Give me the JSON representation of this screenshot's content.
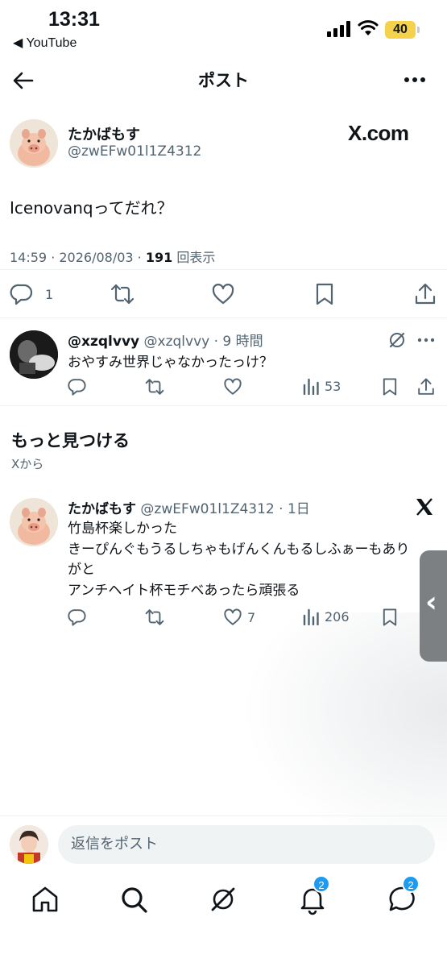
{
  "status_bar": {
    "time": "13:31",
    "back_app": "◀ YouTube",
    "battery": "40"
  },
  "header": {
    "title": "ポスト"
  },
  "main_post": {
    "author_name": "たかばもす",
    "handle": "@zwEFw01l1Z4312",
    "badge": "X.com",
    "text": "Icenovanqってだれ？",
    "timestamp": "14:59 · 2026/08/03 · ",
    "views_count": "191",
    "views_label": " 回表示",
    "reply_count": "1"
  },
  "reply": {
    "author_name": "@xzqlvvy",
    "handle_time": " @xzqlvvy · 9 時間",
    "text": "おやすみ世界じゃなかったっけ？",
    "views": "53"
  },
  "discover": {
    "title": "もっと見つける",
    "subtitle": "Xから"
  },
  "recommended": {
    "author_name": "たかばもす",
    "handle_time": " @zwEFw01l1Z4312 · 1日",
    "lines": [
      "竹島杯楽しかった",
      "きーぴんぐもうるしちゃもげんくんもるしふぁーもありがと",
      "アンチヘイト杯モチベあったら頑張る"
    ],
    "likes": "7",
    "views": "206"
  },
  "compose": {
    "placeholder": "返信をポスト"
  },
  "tabs": {
    "notifications_badge": "2",
    "messages_badge": "2"
  }
}
